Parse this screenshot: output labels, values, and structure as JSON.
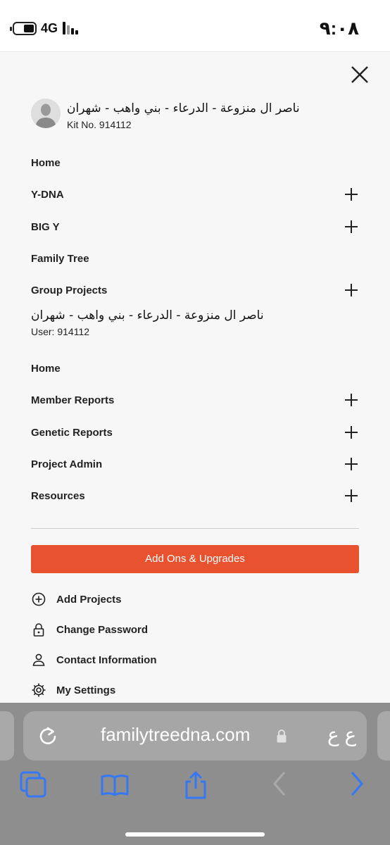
{
  "status_bar": {
    "network": "4G",
    "time": "٩:٠٨"
  },
  "profile": {
    "name": "ناصر ال منزوعة - الدرعاء - بني واهب - شهران",
    "kit_label": "Kit No. 914112"
  },
  "kit_menu": [
    {
      "label": "Home",
      "expandable": false
    },
    {
      "label": "Y-DNA",
      "expandable": true
    },
    {
      "label": "BIG Y",
      "expandable": true
    },
    {
      "label": "Family Tree",
      "expandable": false
    },
    {
      "label": "Group Projects",
      "expandable": true
    }
  ],
  "user": {
    "name": "ناصر ال منزوعة - الدرعاء - بني واهب - شهران",
    "user_label": "User: 914112"
  },
  "project_menu": [
    {
      "label": "Home",
      "expandable": false
    },
    {
      "label": "Member Reports",
      "expandable": true
    },
    {
      "label": "Genetic Reports",
      "expandable": true
    },
    {
      "label": "Project Admin",
      "expandable": true
    },
    {
      "label": "Resources",
      "expandable": true
    }
  ],
  "addons_button": "Add Ons & Upgrades",
  "actions": [
    {
      "label": "Add Projects",
      "icon": "plus-circle-icon"
    },
    {
      "label": "Change Password",
      "icon": "lock-icon"
    },
    {
      "label": "Contact Information",
      "icon": "person-icon"
    },
    {
      "label": "My Settings",
      "icon": "gear-icon"
    }
  ],
  "browser": {
    "url": "familytreedna.com",
    "text_size_label": "ع ع"
  },
  "colors": {
    "accent": "#e8522f",
    "browser_bar": "#8e8e8e",
    "ios_blue": "#3478f6"
  }
}
